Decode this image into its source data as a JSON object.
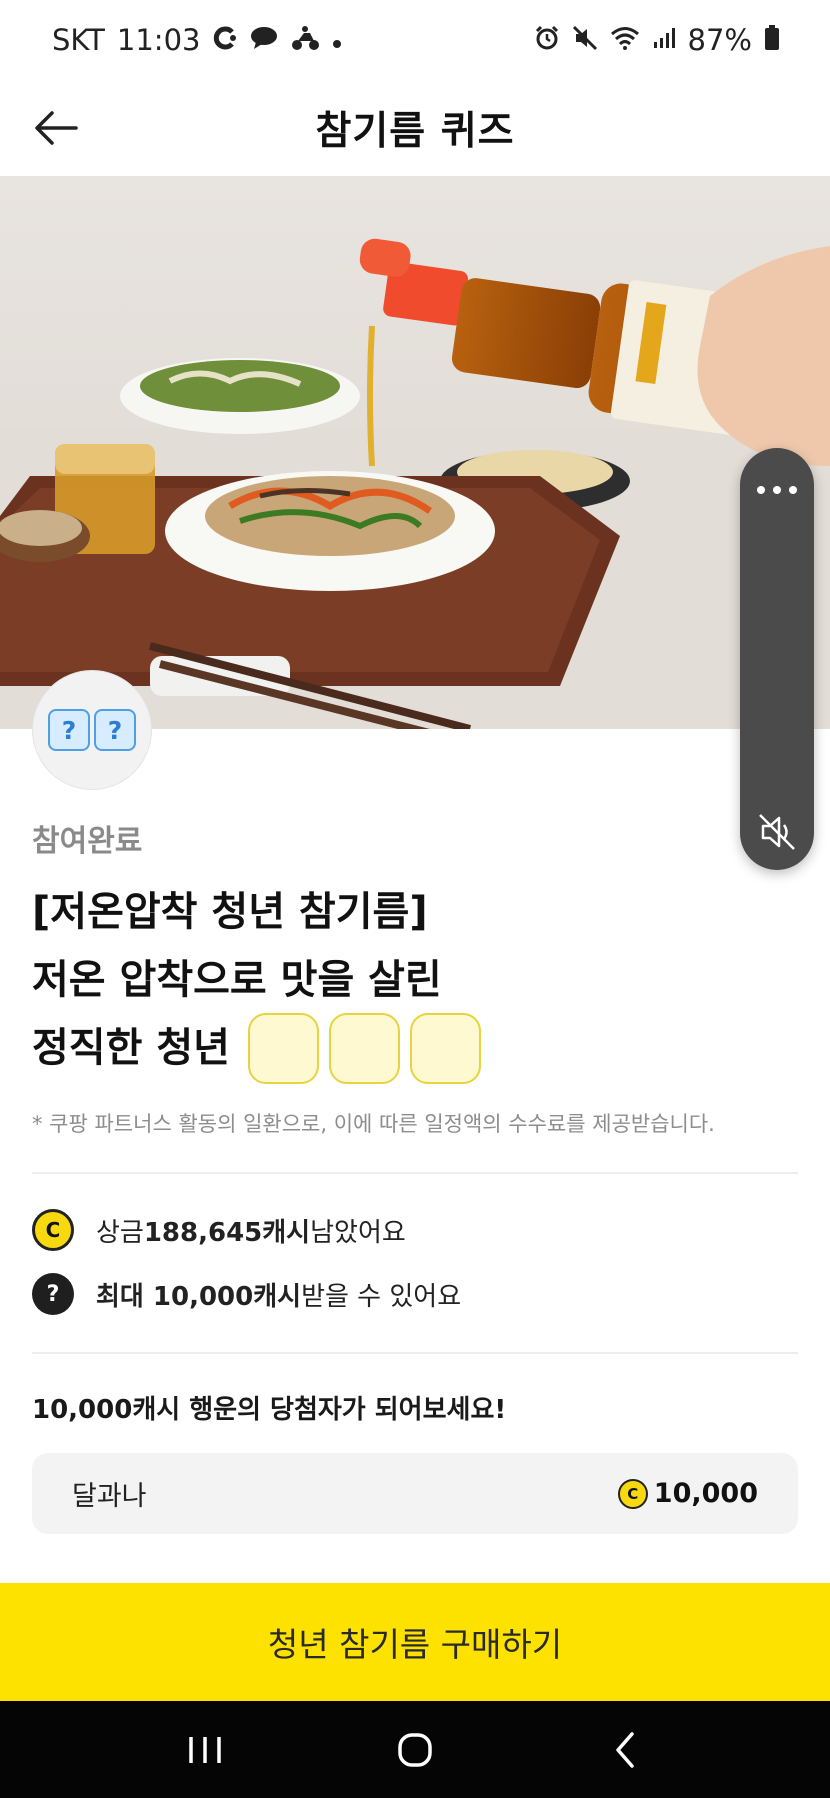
{
  "status_bar": {
    "carrier": "SKT",
    "time": "11:03",
    "battery": "87%",
    "left_icons": [
      "c-logo-icon",
      "speech-bubble-icon",
      "delivery-rider-icon",
      "dot-icon"
    ],
    "right_icons": [
      "alarm-icon",
      "mute-icon",
      "wifi-icon",
      "signal-icon",
      "battery-icon"
    ]
  },
  "header": {
    "title": "참기름 퀴즈"
  },
  "quiz_badge": {
    "symbols": [
      "?",
      "?"
    ]
  },
  "video_controls": {
    "more_icon": "more-dots-icon",
    "mute_icon": "speaker-muted-icon"
  },
  "quiz": {
    "status": "참여완료",
    "line1": "[저온압착 청년 참기름]",
    "line2": "저온 압착으로 맛을 살린",
    "line3": "정직한 청년",
    "answer_box_count": 3,
    "disclaimer": "* 쿠팡 파트너스 활동의 일환으로, 이에 따른 일정액의 수수료를 제공받습니다."
  },
  "rewards": {
    "remaining": {
      "icon_letter": "C",
      "prefix": "상금 ",
      "amount": "188,645캐시",
      "suffix": " 남았어요"
    },
    "max": {
      "icon_letter": "?",
      "amount": "최대 10,000캐시",
      "suffix": " 받을 수 있어요"
    }
  },
  "promo": {
    "title": "10,000캐시 행운의 당첨자가 되어보세요!",
    "prize_name": "달과나",
    "coin_letter": "C",
    "prize_amount": "10,000"
  },
  "cta": {
    "label": "청년 참기름 구매하기"
  },
  "colors": {
    "accent_yellow": "#fde200",
    "answer_box_fill": "#fff9d2",
    "answer_box_border": "#e7d33e",
    "nav_bar": "#050505"
  }
}
